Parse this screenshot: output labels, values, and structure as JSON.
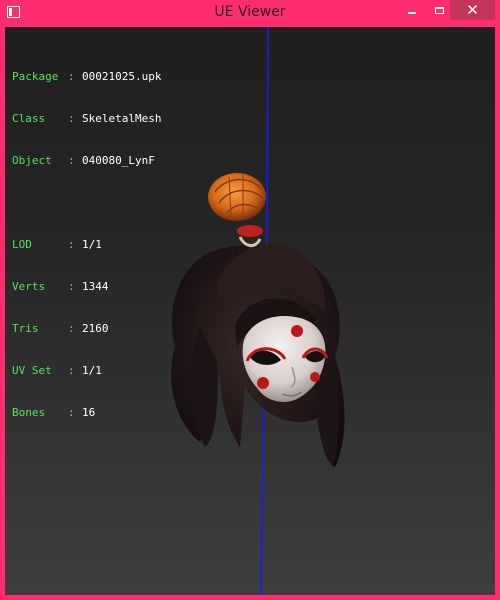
{
  "window": {
    "title": "UE Viewer",
    "controls": {
      "minimize": "minimize",
      "maximize": "maximize",
      "close": "✕"
    }
  },
  "info_panel": {
    "group1": [
      {
        "key": "Package",
        "sep": ":",
        "value": "00021025.upk"
      },
      {
        "key": "Class",
        "sep": ":",
        "value": "SkeletalMesh"
      },
      {
        "key": "Object",
        "sep": ":",
        "value": "040080_LynF"
      }
    ],
    "group2": [
      {
        "key": "LOD",
        "sep": ":",
        "value": "1/1"
      },
      {
        "key": "Verts",
        "sep": ":",
        "value": "1344"
      },
      {
        "key": "Tris",
        "sep": ":",
        "value": "2160"
      },
      {
        "key": "UV Set",
        "sep": ":",
        "value": "1/1"
      },
      {
        "key": "Bones",
        "sep": ":",
        "value": "16"
      }
    ]
  },
  "colors": {
    "frame": "#ff2d6f",
    "close_button": "#c7345a",
    "label_green": "#56e25a",
    "axis_blue": "#1a1aff"
  },
  "icons": {
    "app": "app-icon",
    "minimize": "minimize-icon",
    "maximize": "maximize-icon",
    "close": "close-icon"
  }
}
